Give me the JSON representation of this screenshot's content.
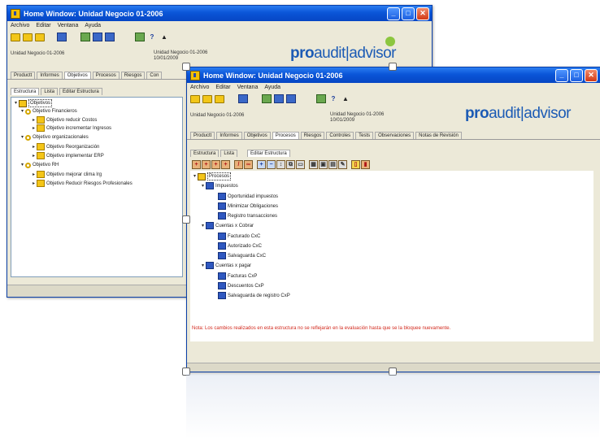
{
  "back_window": {
    "title": "Home Window: Unidad Negocio 01-2006",
    "menu": [
      "Archivo",
      "Editar",
      "Ventana",
      "Ayuda"
    ],
    "unit_label": "Unidad Negocio 01-2006",
    "unit_label2": "Unidad Negocio 01-2006",
    "date": "10/01/2009",
    "tabs": [
      "Productt",
      "Informes",
      "Objetivos",
      "Procesos",
      "Riesgos",
      "Con"
    ],
    "active_tab": "Objetivos",
    "subtabs": [
      "Estructura",
      "Lista",
      "Editar Estructura"
    ],
    "tree": {
      "root": "Objetivos",
      "groups": [
        {
          "label": "Objetivo Financieros",
          "items": [
            "Objetivo reducir Costos",
            "Objetivo incrementar Ingresos"
          ]
        },
        {
          "label": "Objetivo organizacionales",
          "items": [
            "Objetivo Reorganización",
            "Objetivo implementar ERP"
          ]
        },
        {
          "label": "Objetivo RH",
          "items": [
            "Objetivo mejorar clima lrg",
            "Objetivo Reducir Riesgos Profesionales"
          ]
        }
      ]
    }
  },
  "front_window": {
    "title": "Home Window: Unidad Negocio 01-2006",
    "menu": [
      "Archivo",
      "Editar",
      "Ventana",
      "Ayuda"
    ],
    "unit_label": "Unidad Negocio 01-2006",
    "unit_label2": "Unidad Negocio 01-2006",
    "date": "10/01/2009",
    "tabs": [
      "Productt",
      "Informes",
      "Objetivos",
      "Procesos",
      "Riesgos",
      "Controles",
      "Tests",
      "Observaciones",
      "Notas de Revisión"
    ],
    "active_tab": "Procesos",
    "subtabs": [
      "Estructura",
      "Lista",
      "Editar Estructura"
    ],
    "tree": {
      "root": "Procesos",
      "groups": [
        {
          "label": "Impuestos",
          "items": [
            "Oportunidad impuestos",
            "Minimizar Obligaciones",
            "Registro transacciones"
          ]
        },
        {
          "label": "Cuentas x Cobrar",
          "items": [
            "Facturado CxC",
            "Autorizado CxC",
            "Salvaguarda CxC"
          ]
        },
        {
          "label": "Cuentas x pagar",
          "items": [
            "Facturas CxP",
            "Descuentos CxP",
            "Salvaguarda de registro CxP"
          ]
        }
      ]
    },
    "note": "Nota: Los cambios realizados en esta estructura no se reflejarán en la evaluación hasta que se la bloquee nuevamente."
  },
  "logo": {
    "pro": "pro",
    "audit": "audit",
    "advisor": "advisor",
    "color": "#1c5bb5"
  },
  "colors": {
    "titlebar": "#0a55d8",
    "note": "#d2281c",
    "folder": "#f4c518",
    "process": "#2f58c0"
  }
}
